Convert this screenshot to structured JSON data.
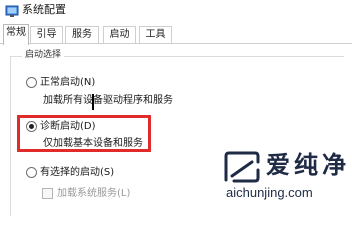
{
  "window": {
    "title": "系统配置"
  },
  "tabs": [
    {
      "label": "常规"
    },
    {
      "label": "引导"
    },
    {
      "label": "服务"
    },
    {
      "label": "启动"
    },
    {
      "label": "工具"
    }
  ],
  "startup_group": {
    "legend": "启动选择",
    "options": [
      {
        "label": "正常启动(N)",
        "description": "加载所有设备驱动程序和服务",
        "checked": false
      },
      {
        "label": "诊断启动(D)",
        "description": "仅加载基本设备和服务",
        "checked": true
      },
      {
        "label": "有选择的启动(S)",
        "sub_option": "加载系统服务(L)",
        "checked": false
      }
    ]
  },
  "colors": {
    "highlight": "#e02b2b",
    "watermark": "#1f2a44"
  },
  "watermark": {
    "brand": "爱纯净",
    "url": "aichunjing.com"
  }
}
